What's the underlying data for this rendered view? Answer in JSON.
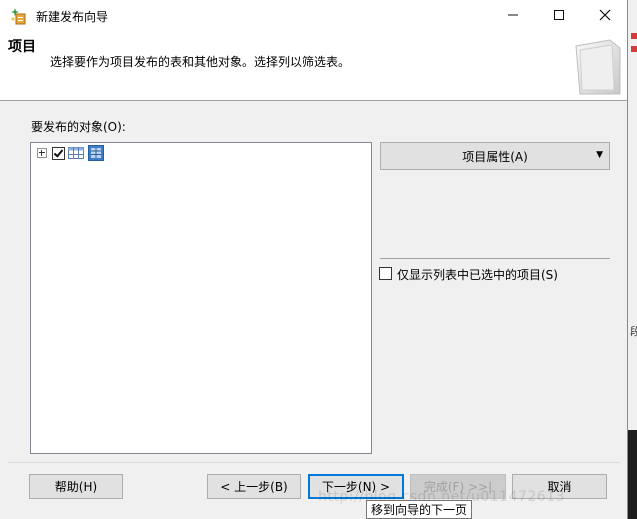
{
  "window": {
    "title": "新建发布向导",
    "controls": {
      "minimize": "—",
      "maximize": "☐",
      "close": "✕"
    }
  },
  "header": {
    "title": "项目",
    "description": "选择要作为项目发布的表和其他对象。选择列以筛选表。"
  },
  "objects": {
    "label": "要发布的对象(O):",
    "tree_items": [
      {
        "icon": "table-icon",
        "checked": true,
        "expanded": false
      }
    ]
  },
  "properties_button": {
    "label": "项目属性(A)"
  },
  "filter_checkbox": {
    "label": "仅显示列表中已选中的项目(S)",
    "checked": false
  },
  "footer": {
    "help": "帮助(H)",
    "back": "< 上一步(B)",
    "next": "下一步(N) >",
    "finish": "完成(F) >>|",
    "cancel": "取消"
  },
  "tooltip": "移到向导的下一页",
  "watermark": "http://blog.csdn.net/u011472613",
  "colors": {
    "dialog_bg": "#f0f0f0",
    "header_bg": "#ffffff",
    "button_bg": "#e1e1e1",
    "focus_border": "#0078d7"
  }
}
